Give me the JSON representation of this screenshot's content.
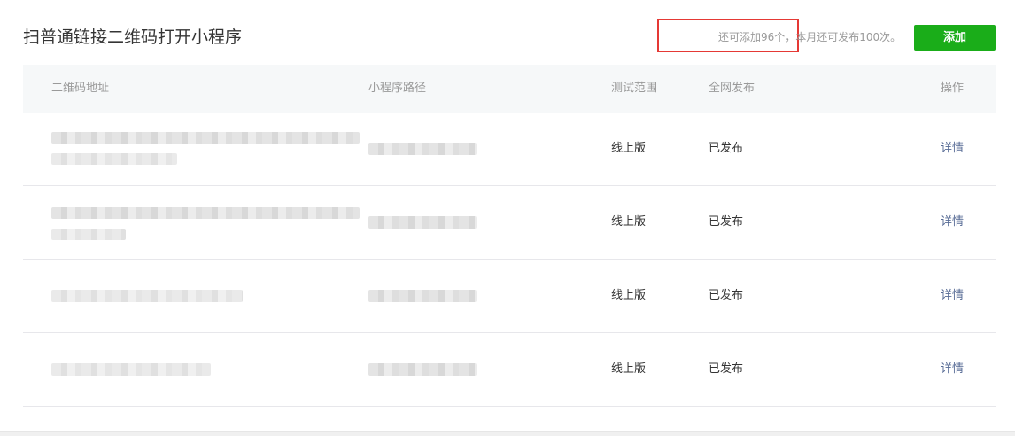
{
  "header": {
    "title": "扫普通链接二维码打开小程序",
    "quota_text": "还可添加96个，本月还可发布100次。",
    "add_button_label": "添加"
  },
  "table": {
    "columns": [
      "二维码地址",
      "小程序路径",
      "测试范围",
      "全网发布",
      "操作"
    ],
    "rows": [
      {
        "qr_url": "",
        "path": "",
        "test_scope": "线上版",
        "publish_status": "已发布",
        "action": "详情"
      },
      {
        "qr_url": "",
        "path": "",
        "test_scope": "线上版",
        "publish_status": "已发布",
        "action": "详情"
      },
      {
        "qr_url": "",
        "path": "",
        "test_scope": "线上版",
        "publish_status": "已发布",
        "action": "详情"
      },
      {
        "qr_url": "",
        "path": "",
        "test_scope": "线上版",
        "publish_status": "已发布",
        "action": "详情"
      }
    ]
  },
  "colors": {
    "accent_green": "#1aad19",
    "highlight_red": "#e53935",
    "link_blue": "#576b95",
    "header_bg": "#f6f8f9"
  }
}
